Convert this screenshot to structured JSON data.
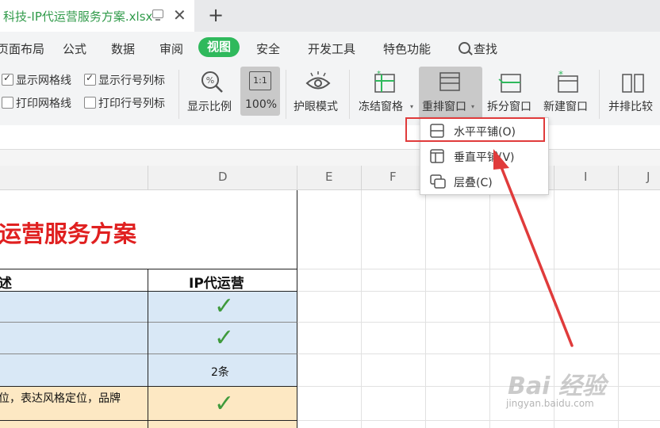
{
  "tab": {
    "title": "科技-IP代运营服务方案.xlsx",
    "close": "✕",
    "new_tab": "+"
  },
  "menu": {
    "items": [
      "页面布局",
      "公式",
      "数据",
      "审阅",
      "视图",
      "安全",
      "开发工具",
      "特色功能"
    ],
    "search": "查找"
  },
  "ribbon": {
    "show_gridlines": "显示网格线",
    "show_headers": "显示行号列标",
    "print_gridlines": "打印网格线",
    "print_headers": "打印行号列标",
    "zoom_label": "显示比例",
    "zoom_value": "100%",
    "zoom_icon_text": "1:1",
    "eye_mode": "护眼模式",
    "freeze": "冻结窗格",
    "arrange": "重排窗口",
    "split": "拆分窗口",
    "new_window": "新建窗口",
    "side_by_side": "并排比较",
    "checkboxes": {
      "show_gridlines": true,
      "show_headers": true,
      "print_gridlines": false,
      "print_headers": false
    }
  },
  "dropdown": {
    "items": [
      "水平平铺(O)",
      "垂直平铺(V)",
      "层叠(C)"
    ]
  },
  "columns": [
    "D",
    "E",
    "F",
    "G",
    "H",
    "I",
    "J"
  ],
  "sheet": {
    "title": "运营服务方案",
    "header_left": "述",
    "header_d": "IP代运营",
    "check_mark": "✓",
    "row3_d": "2条",
    "row4_left": "位，表达风格定位，品牌"
  },
  "watermark": {
    "brand": "Bai 经验",
    "url": "jingyan.baidu.com"
  },
  "colors": {
    "accent": "#2fb95c",
    "title_red": "#e02020",
    "row_blue": "#d9e8f6",
    "row_yellow": "#fde8c3",
    "arrow": "#e03b3b"
  }
}
